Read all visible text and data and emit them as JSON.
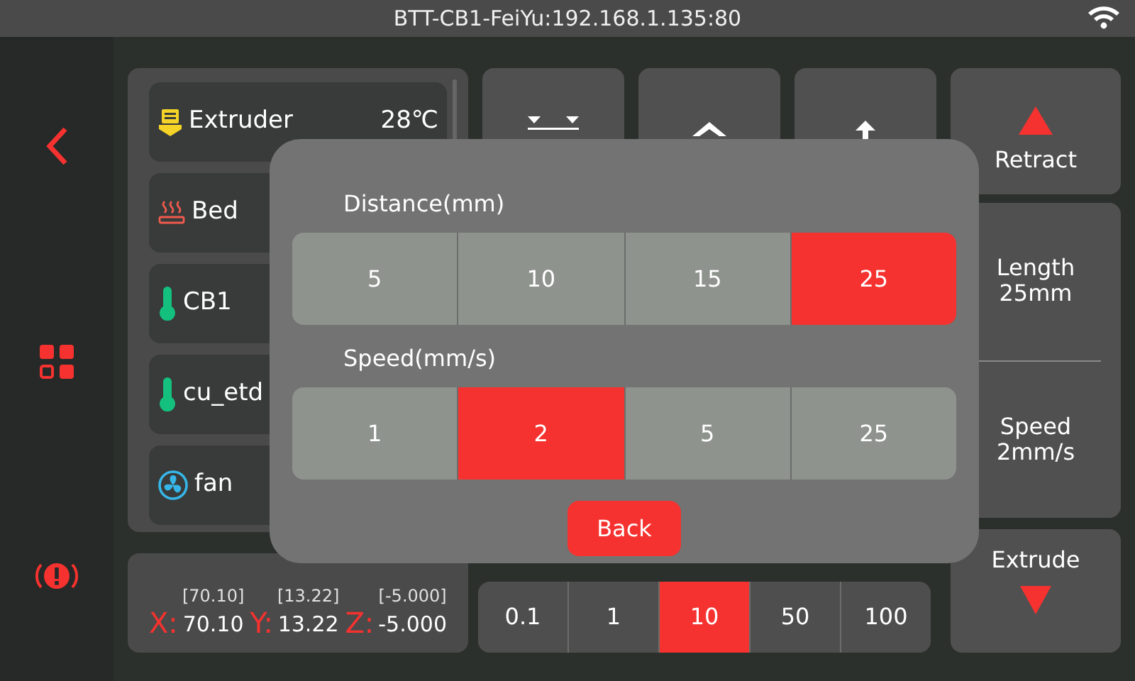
{
  "header": {
    "title": "BTT-CB1-FeiYu:192.168.1.135:80"
  },
  "temperatures": [
    {
      "kind": "extruder",
      "name": "Extruder",
      "value": "28℃"
    },
    {
      "kind": "bed",
      "name": "Bed"
    },
    {
      "kind": "thermometer",
      "name": "CB1"
    },
    {
      "kind": "thermometer",
      "name": "cu_etd"
    },
    {
      "kind": "fan",
      "name": "fan"
    }
  ],
  "coordinates": [
    {
      "axis": "X:",
      "target": "[70.10]",
      "value": "70.10"
    },
    {
      "axis": "Y:",
      "target": "[13.22]",
      "value": "13.22"
    },
    {
      "axis": "Z:",
      "target": "[-5.000]",
      "value": "-5.000"
    }
  ],
  "increments": [
    {
      "label": "0.1",
      "selected": false
    },
    {
      "label": "1",
      "selected": false
    },
    {
      "label": "10",
      "selected": true
    },
    {
      "label": "50",
      "selected": false
    },
    {
      "label": "100",
      "selected": false
    }
  ],
  "retract": {
    "label": "Retract"
  },
  "settings": [
    {
      "label": "Length",
      "value": "25mm"
    },
    {
      "label": "Speed",
      "value": "2mm/s"
    }
  ],
  "extrude": {
    "label": "Extrude"
  },
  "dialog": {
    "groups": [
      {
        "title": "Distance(mm)",
        "options": [
          {
            "label": "5",
            "selected": false
          },
          {
            "label": "10",
            "selected": false
          },
          {
            "label": "15",
            "selected": false
          },
          {
            "label": "25",
            "selected": true
          }
        ]
      },
      {
        "title": "Speed(mm/s)",
        "options": [
          {
            "label": "1",
            "selected": false
          },
          {
            "label": "2",
            "selected": true
          },
          {
            "label": "5",
            "selected": false
          },
          {
            "label": "25",
            "selected": false
          }
        ]
      }
    ],
    "back": "Back"
  }
}
